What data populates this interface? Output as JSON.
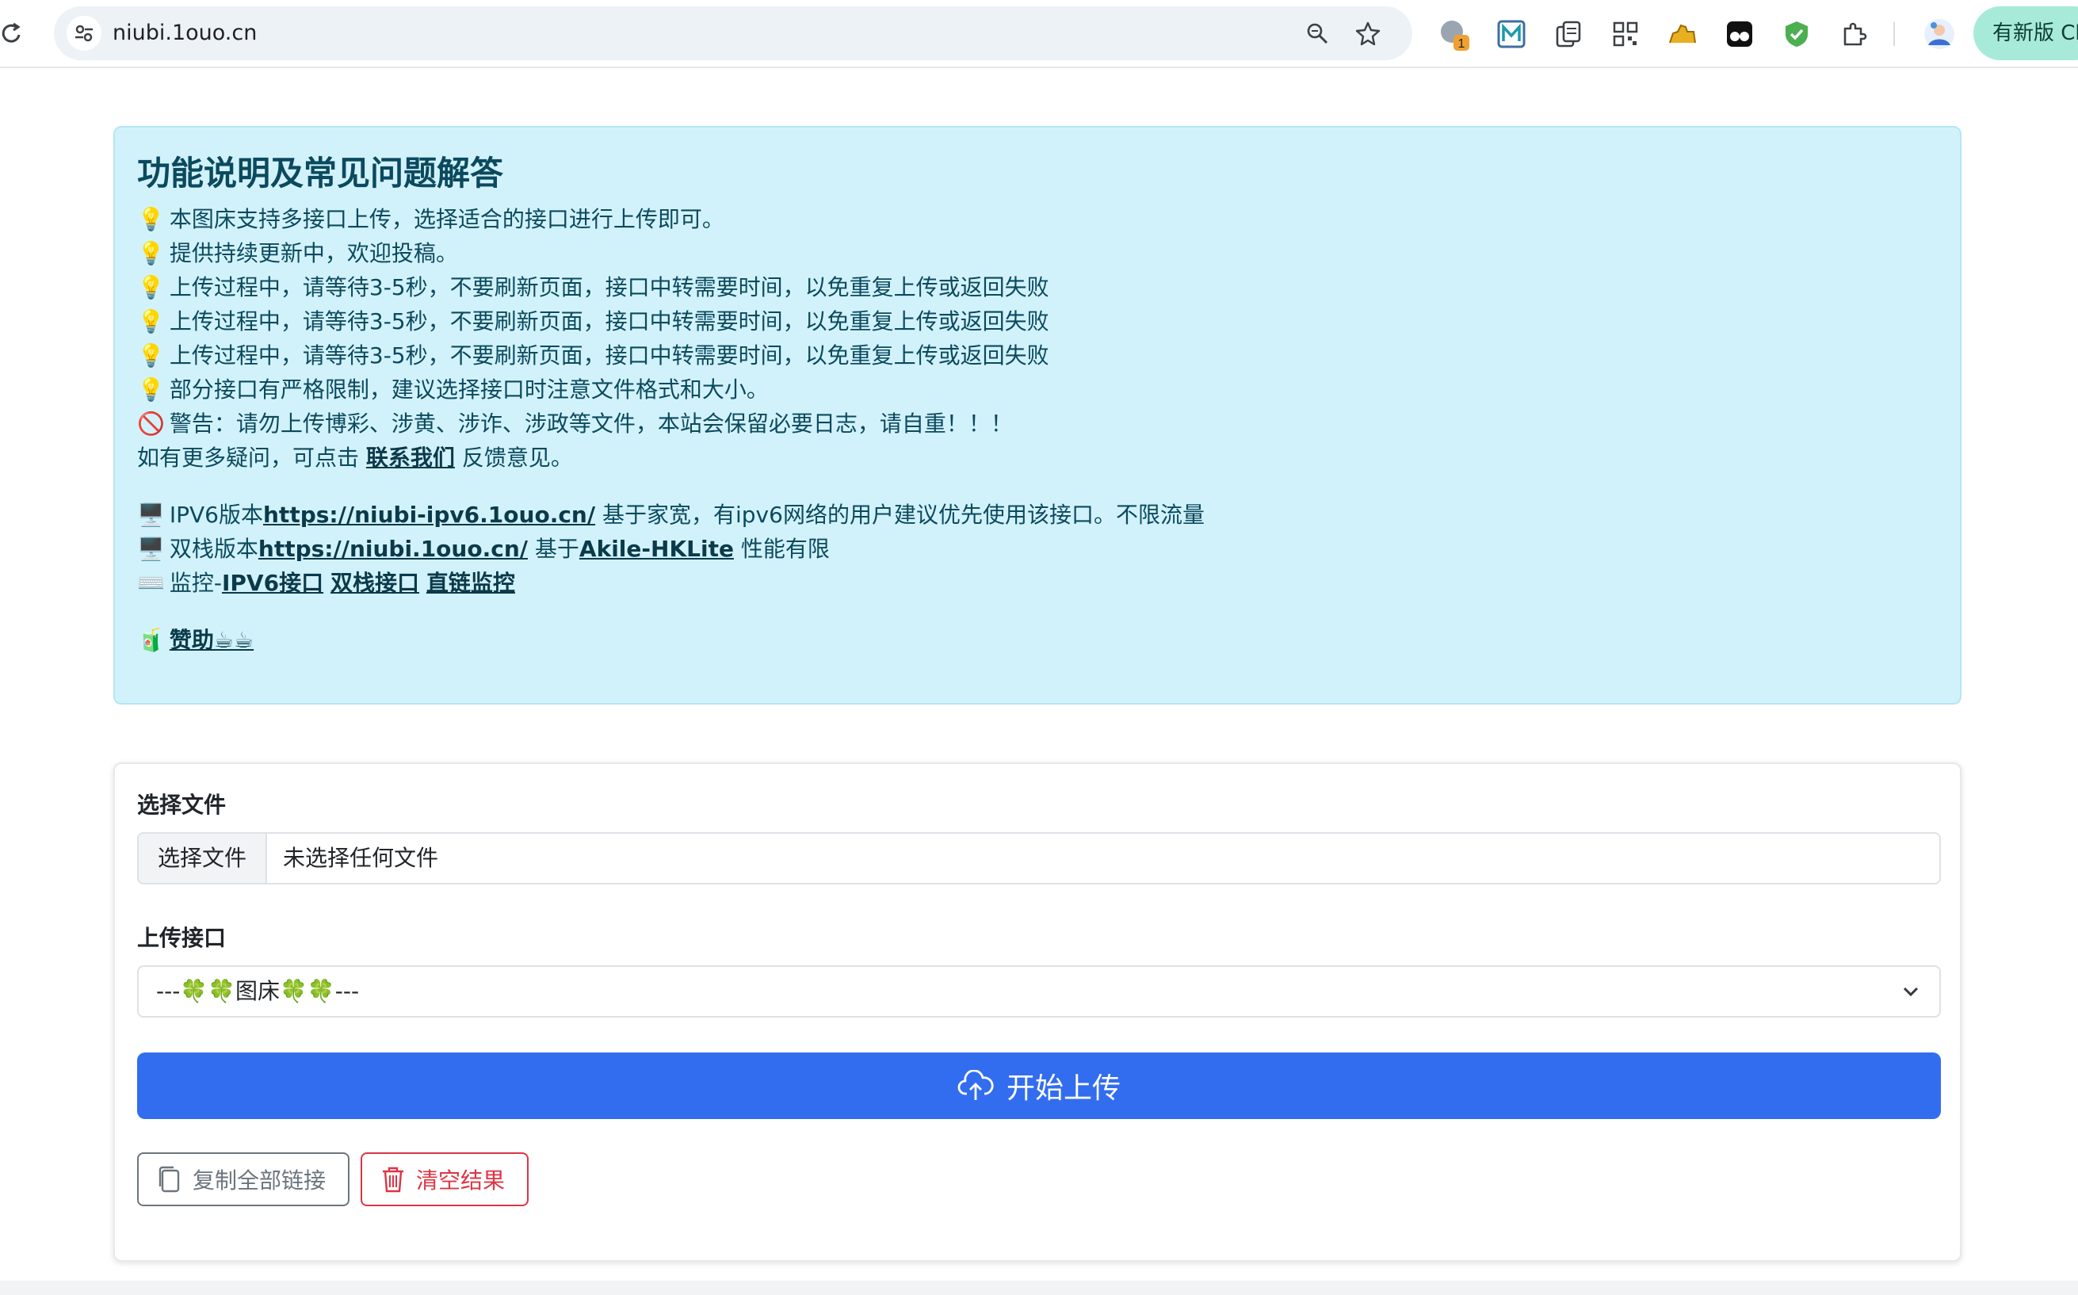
{
  "browser": {
    "url": "niubi.1ouo.cn",
    "extension_badge": "1",
    "update_button": "有新版 Ch"
  },
  "info": {
    "title": "功能说明及常见问题解答",
    "tips": [
      "本图床支持多接口上传，选择适合的接口进行上传即可。",
      "提供持续更新中，欢迎投稿。",
      "上传过程中，请等待3-5秒，不要刷新页面，接口中转需要时间，以免重复上传或返回失败",
      "上传过程中，请等待3-5秒，不要刷新页面，接口中转需要时间，以免重复上传或返回失败",
      "上传过程中，请等待3-5秒，不要刷新页面，接口中转需要时间，以免重复上传或返回失败",
      "部分接口有严格限制，建议选择接口时注意文件格式和大小。"
    ],
    "tip_icon": "💡",
    "warning_icon": "🚫",
    "warning": "警告：请勿上传博彩、涉黄、涉诈、涉政等文件，本站会保留必要日志，请自重！！！",
    "contact_prefix": "如有更多疑问，可点击",
    "contact_link": "联系我们",
    "contact_suffix": "反馈意见。",
    "ipv6_icon": "🖥️",
    "ipv6_prefix": "IPV6版本",
    "ipv6_link": "https://niubi-ipv6.1ouo.cn/",
    "ipv6_suffix": "基于家宽，有ipv6网络的用户建议优先使用该接口。不限流量",
    "dual_icon": "🖥️",
    "dual_prefix": "双栈版本",
    "dual_link": "https://niubi.1ouo.cn/",
    "dual_mid": "基于",
    "dual_link2": "Akile-HKLite",
    "dual_suffix": "性能有限",
    "monitor_icon": "⌨️",
    "monitor_prefix": "监控-",
    "monitor_links": [
      "IPV6接口",
      "双栈接口",
      "直链监控"
    ],
    "sponsor_icon": "🧃",
    "sponsor_link": "赞助☕☕"
  },
  "upload": {
    "file_label": "选择文件",
    "file_button": "选择文件",
    "file_status": "未选择任何文件",
    "api_label": "上传接口",
    "api_selected": "---🍀🍀图床🍀🍀---",
    "start_button": "开始上传",
    "copy_button": "复制全部链接",
    "clear_button": "清空结果"
  },
  "colors": {
    "info_bg": "#d2f2fb",
    "primary": "#326df0",
    "danger": "#dc3545",
    "secondary": "#6c757d"
  }
}
